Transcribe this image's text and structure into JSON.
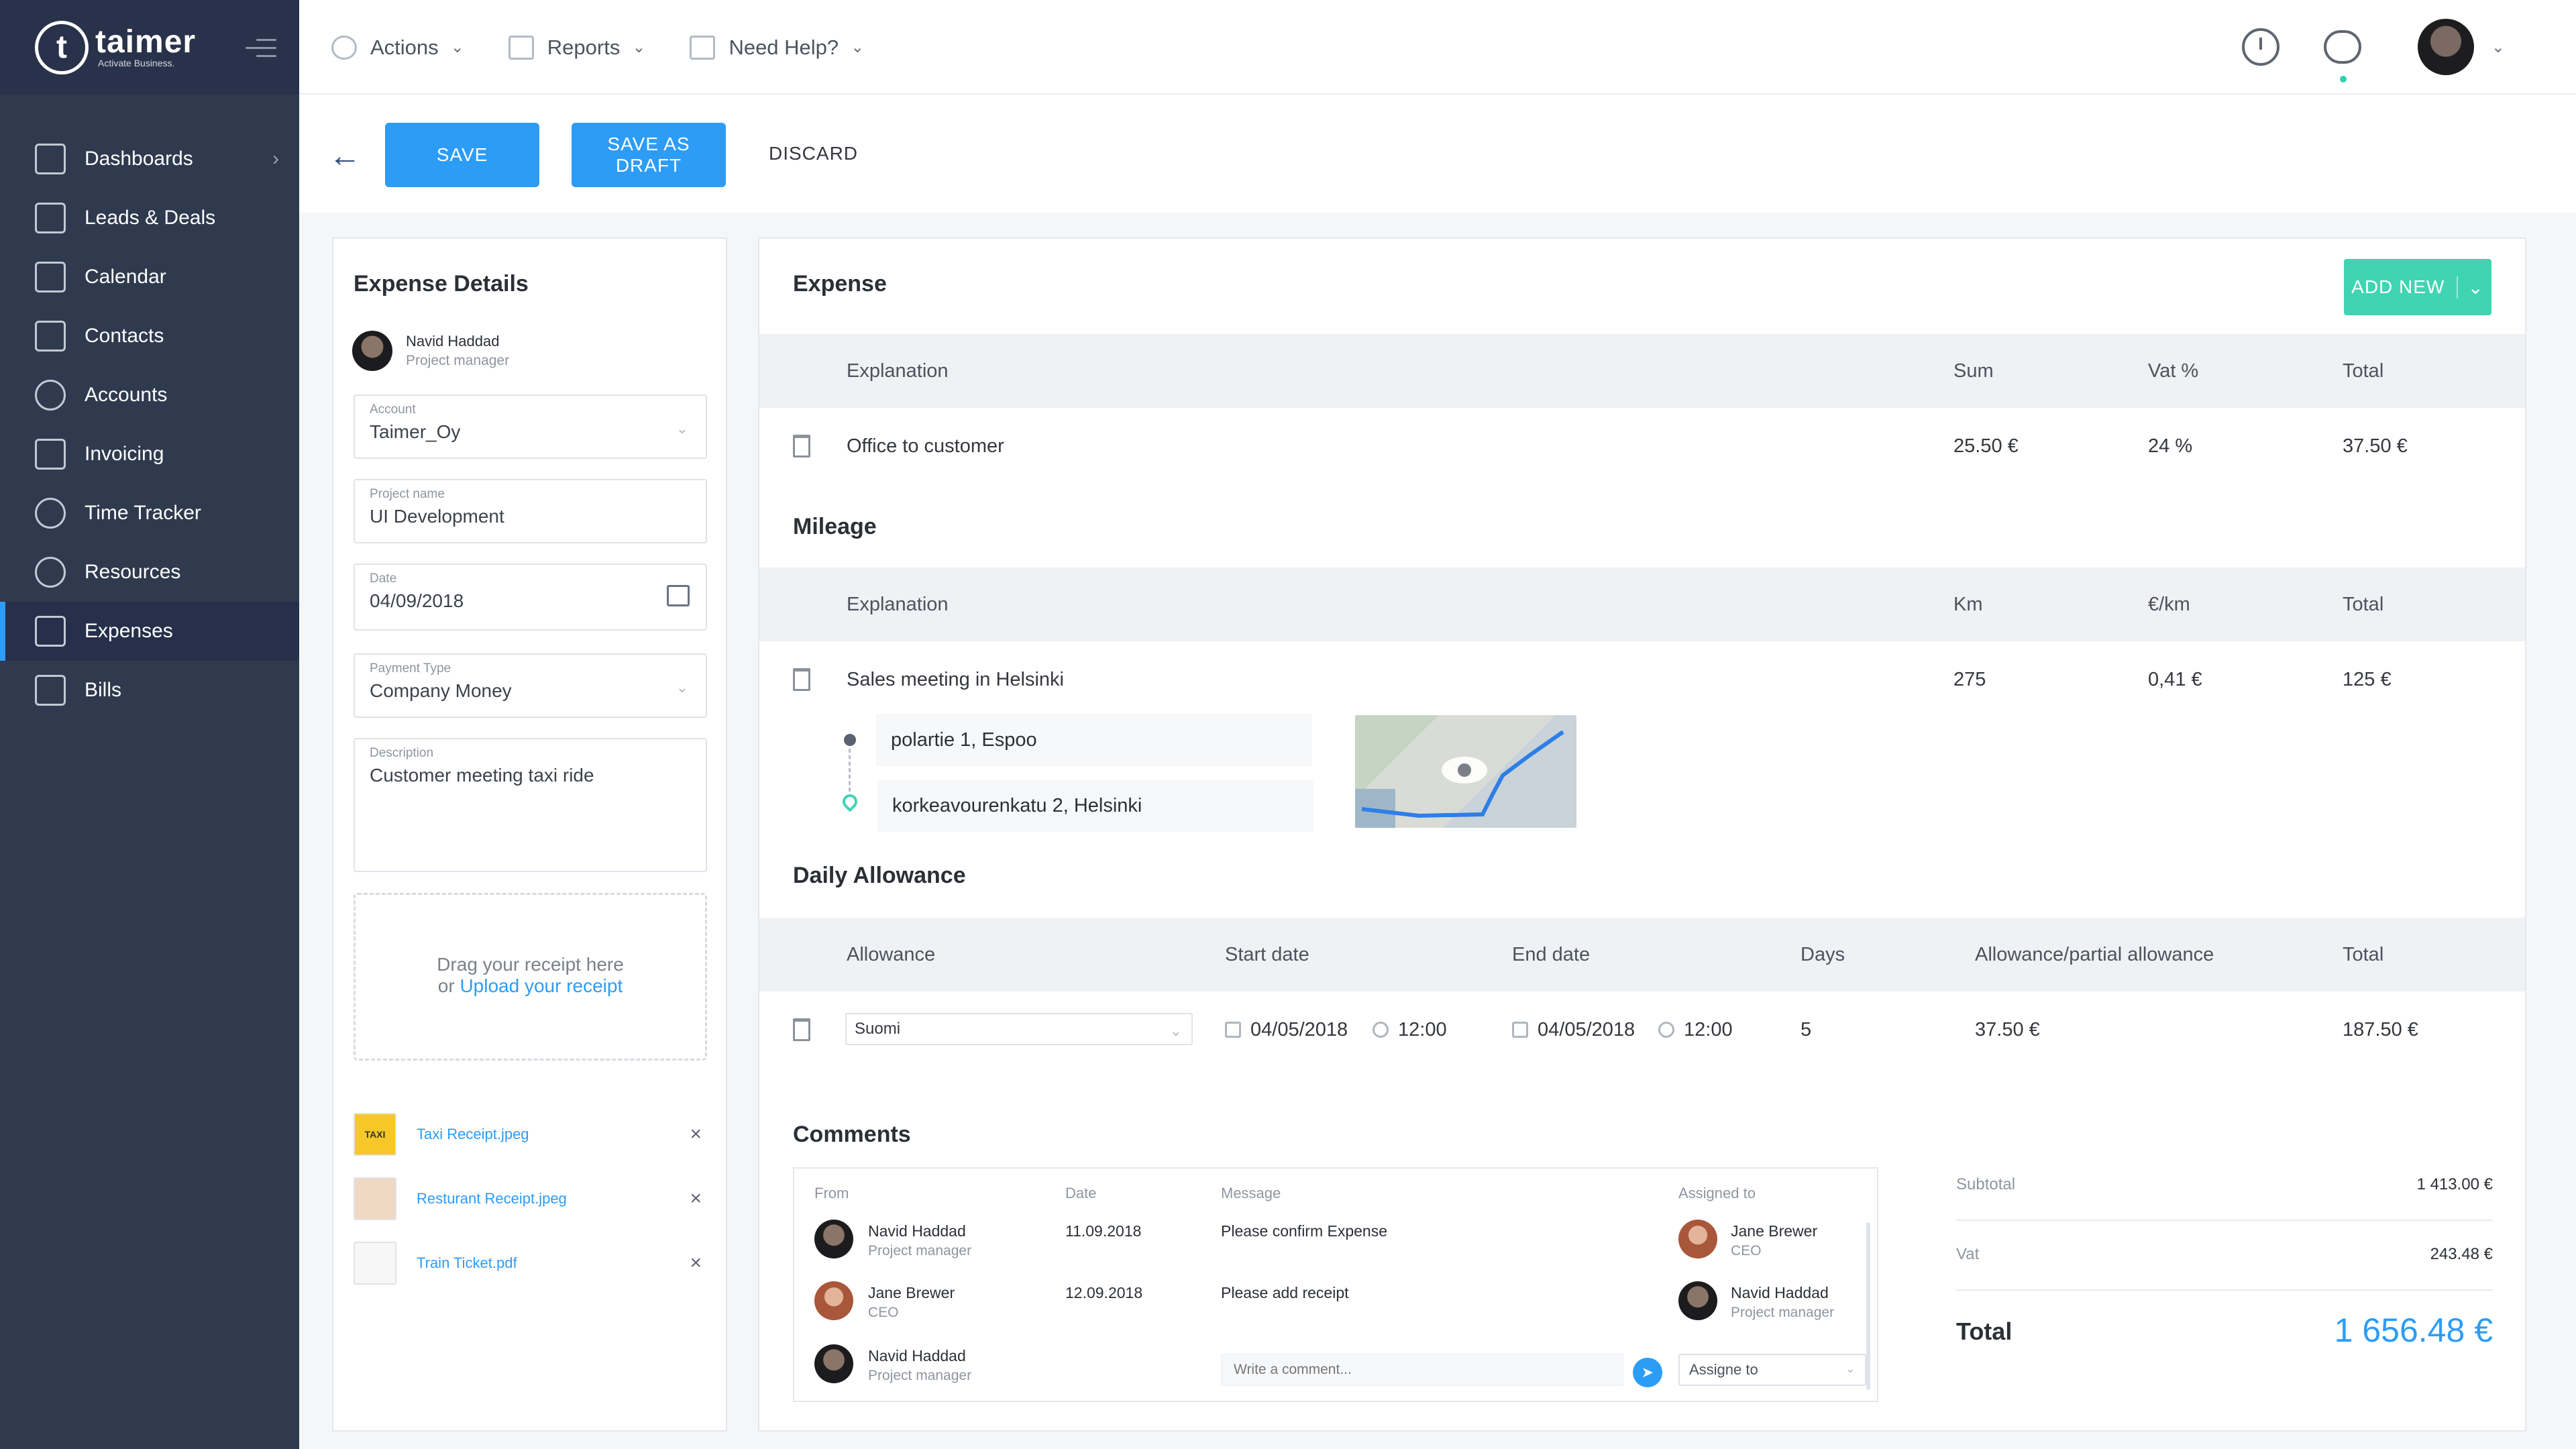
{
  "brand": {
    "name": "taimer",
    "tagline": "Activate Business."
  },
  "sidebar": {
    "items": [
      {
        "label": "Dashboards",
        "icon": "dashboard-icon",
        "has_children": true
      },
      {
        "label": "Leads & Deals",
        "icon": "handshake-icon"
      },
      {
        "label": "Calendar",
        "icon": "calendar-icon"
      },
      {
        "label": "Contacts",
        "icon": "contacts-icon"
      },
      {
        "label": "Accounts",
        "icon": "user-icon"
      },
      {
        "label": "Invoicing",
        "icon": "invoice-icon"
      },
      {
        "label": "Time Tracker",
        "icon": "stopwatch-icon"
      },
      {
        "label": "Resources",
        "icon": "resources-icon"
      },
      {
        "label": "Expenses",
        "icon": "expenses-icon",
        "active": true
      },
      {
        "label": "Bills",
        "icon": "bills-icon"
      }
    ]
  },
  "topbar": {
    "menu": [
      {
        "label": "Actions",
        "icon": "plus-circle-icon"
      },
      {
        "label": "Reports",
        "icon": "chart-icon"
      },
      {
        "label": "Need Help?",
        "icon": "book-icon"
      }
    ]
  },
  "toolbar": {
    "save": "SAVE",
    "save_draft": "SAVE AS DRAFT",
    "discard": "DISCARD"
  },
  "details": {
    "title": "Expense Details",
    "user": {
      "name": "Navid Haddad",
      "role": "Project manager"
    },
    "account": {
      "label": "Account",
      "value": "Taimer_Oy"
    },
    "project": {
      "label": "Project name",
      "value": "UI Development"
    },
    "date": {
      "label": "Date",
      "value": "04/09/2018"
    },
    "payment": {
      "label": "Payment Type",
      "value": "Company Money"
    },
    "description": {
      "label": "Description",
      "value": "Customer meeting taxi ride"
    },
    "dropzone": {
      "line1": "Drag your receipt here",
      "or": "or",
      "upload": "Upload",
      "receipt": "your receipt"
    },
    "attachments": [
      {
        "name": "Taxi Receipt.jpeg",
        "thumb": "TAXI"
      },
      {
        "name": "Resturant Receipt.jpeg",
        "thumb": ""
      },
      {
        "name": "Train Ticket.pdf",
        "thumb": ""
      }
    ]
  },
  "expense": {
    "title": "Expense",
    "add_new": "ADD NEW",
    "headers": {
      "explanation": "Explanation",
      "sum": "Sum",
      "vat": "Vat %",
      "total": "Total"
    },
    "rows": [
      {
        "explanation": "Office to customer",
        "sum": "25.50 €",
        "vat": "24 %",
        "total": "37.50 €"
      }
    ]
  },
  "mileage": {
    "title": "Mileage",
    "headers": {
      "explanation": "Explanation",
      "km": "Km",
      "per_km": "€/km",
      "total": "Total"
    },
    "rows": [
      {
        "explanation": "Sales meeting in Helsinki",
        "km": "275",
        "per_km": "0,41 €",
        "total": "125 €"
      }
    ],
    "route": {
      "from": "polartie 1, Espoo",
      "to": "korkeavourenkatu 2, Helsinki"
    }
  },
  "allowance": {
    "title": "Daily Allowance",
    "headers": {
      "allowance": "Allowance",
      "start": "Start date",
      "end": "End date",
      "days": "Days",
      "partial": "Allowance/partial allowance",
      "total": "Total"
    },
    "rows": [
      {
        "allowance": "Suomi",
        "start_date": "04/05/2018",
        "start_time": "12:00",
        "end_date": "04/05/2018",
        "end_time": "12:00",
        "days": "5",
        "partial": "37.50 €",
        "total": "187.50 €"
      }
    ]
  },
  "comments": {
    "title": "Comments",
    "headers": {
      "from": "From",
      "date": "Date",
      "message": "Message",
      "assigned": "Assigned to"
    },
    "rows": [
      {
        "from_name": "Navid Haddad",
        "from_role": "Project manager",
        "date": "11.09.2018",
        "message": "Please confirm Expense",
        "to_name": "Jane Brewer",
        "to_role": "CEO"
      },
      {
        "from_name": "Jane Brewer",
        "from_role": "CEO",
        "date": "12.09.2018",
        "message": "Please add receipt",
        "to_name": "Navid Haddad",
        "to_role": "Project manager"
      }
    ],
    "current_user": {
      "name": "Navid Haddad",
      "role": "Project manager"
    },
    "input_placeholder": "Write a comment...",
    "assign_placeholder": "Assigne to"
  },
  "totals": {
    "subtotal_label": "Subtotal",
    "subtotal": "1 413.00 €",
    "vat_label": "Vat",
    "vat": "243.48 €",
    "total_label": "Total",
    "total": "1 656.48 €"
  },
  "colors": {
    "primary": "#2d9cf7",
    "accent": "#3fd5b3",
    "sidebar": "#2f3a4e"
  }
}
